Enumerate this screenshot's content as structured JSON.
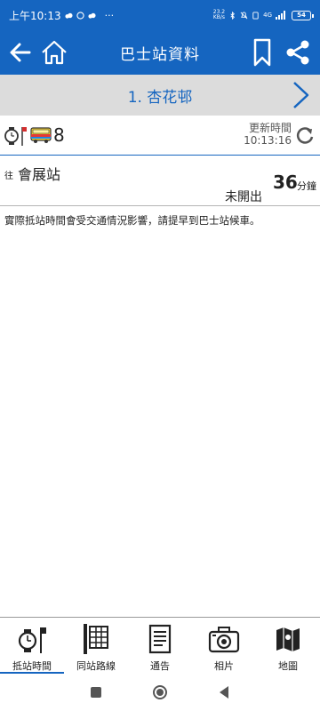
{
  "status_bar": {
    "time": "上午10:13",
    "extra": "···",
    "net_speed_value": "23.2",
    "net_speed_unit": "KB/s",
    "network_type": "4G",
    "battery": "54"
  },
  "app_bar": {
    "title": "巴士站資料",
    "icons": [
      "back-arrow-icon",
      "home-icon",
      "bookmark-icon",
      "share-icon"
    ]
  },
  "stop": {
    "name": "1. 杏花邨"
  },
  "route": {
    "number": "8",
    "update_label": "更新時間",
    "update_time": "10:13:16"
  },
  "eta": {
    "to_prefix": "往",
    "destination": "會展站",
    "status": "未開出",
    "minutes": "36",
    "unit": "分鐘"
  },
  "notice": "實際抵站時間會受交通情況影響，請提早到巴士站候車。",
  "bottom_nav": [
    {
      "label": "抵站時間",
      "icon": "clock-stop-icon",
      "active": true
    },
    {
      "label": "同站路線",
      "icon": "route-list-icon",
      "active": false
    },
    {
      "label": "通告",
      "icon": "notice-icon",
      "active": false
    },
    {
      "label": "相片",
      "icon": "camera-icon",
      "active": false
    },
    {
      "label": "地圖",
      "icon": "map-icon",
      "active": false
    }
  ],
  "colors": {
    "primary": "#1565c0",
    "header_gray": "#dcdcdc"
  }
}
